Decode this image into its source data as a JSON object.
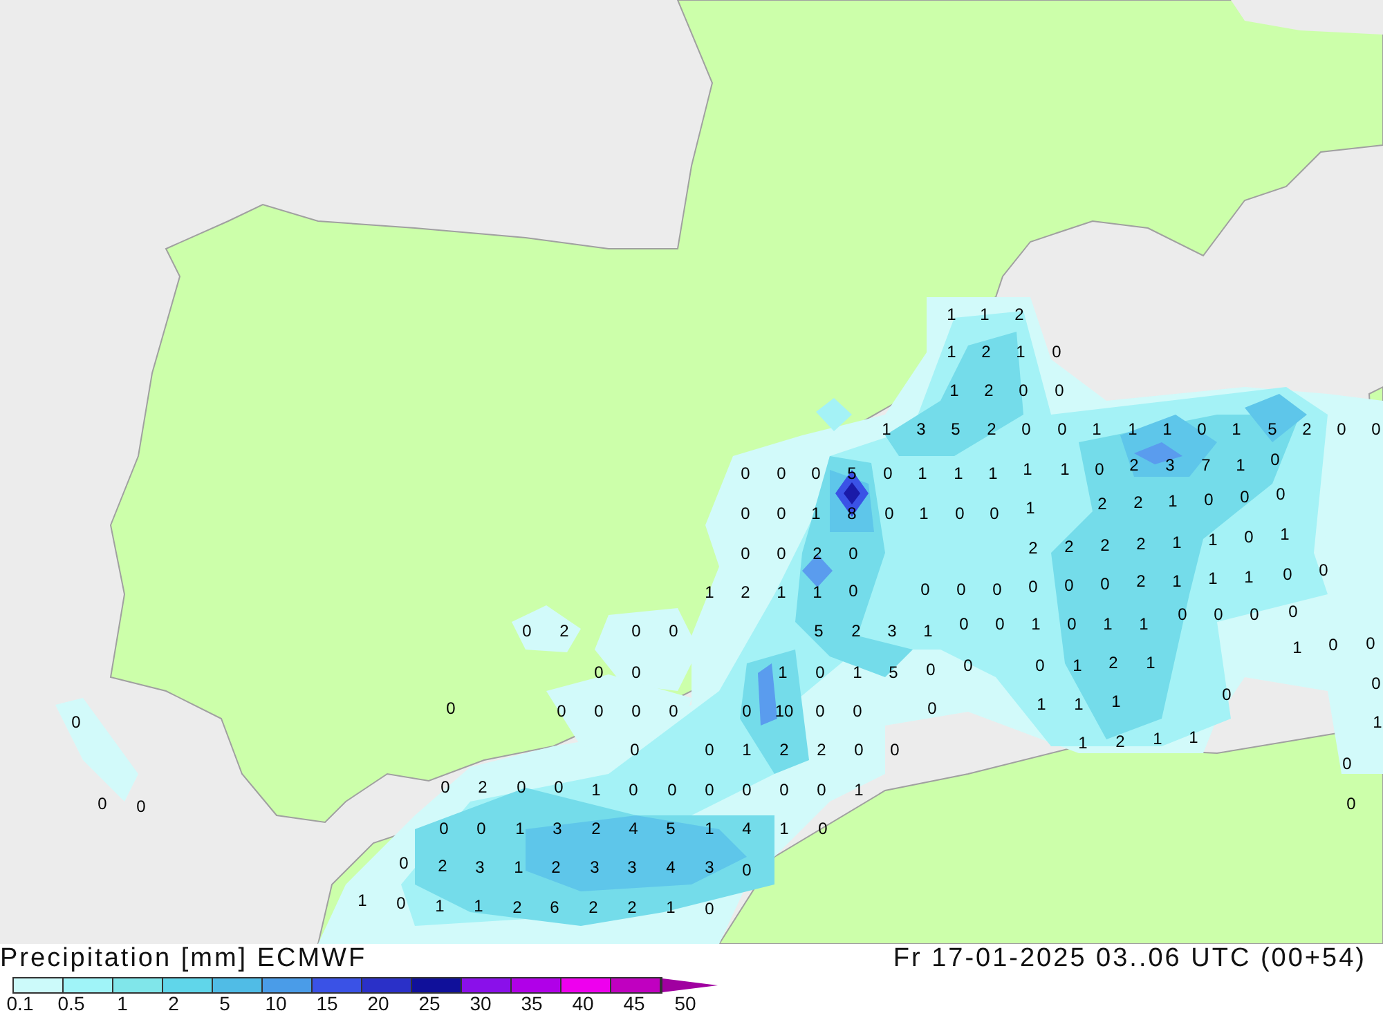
{
  "map": {
    "values": [
      "1",
      "1",
      "2",
      "1",
      "2",
      "1",
      "0",
      "1",
      "2",
      "0",
      "0",
      "1",
      "3",
      "5",
      "2",
      "0",
      "0",
      "1",
      "1",
      "1",
      "0",
      "1",
      "5",
      "2",
      "0",
      "0",
      "0",
      "0",
      "0",
      "5",
      "0",
      "1",
      "1",
      "1",
      "1",
      "1",
      "0",
      "2",
      "3",
      "7",
      "1",
      "0",
      "0",
      "0",
      "1",
      "8",
      "0",
      "1",
      "0",
      "0",
      "1",
      "2",
      "2",
      "1",
      "0",
      "0",
      "0",
      "0",
      "0",
      "2",
      "0",
      "2",
      "2",
      "2",
      "2",
      "1",
      "1",
      "0",
      "1",
      "1",
      "2",
      "1",
      "1",
      "0",
      "0",
      "0",
      "0",
      "0",
      "0",
      "0",
      "2",
      "1",
      "1",
      "1",
      "0",
      "0",
      "5",
      "2",
      "3",
      "1",
      "0",
      "0",
      "1",
      "0",
      "1",
      "1",
      "0",
      "0",
      "0",
      "0",
      "0",
      "2",
      "0",
      "0",
      "1",
      "0",
      "0",
      "0",
      "0",
      "1",
      "0",
      "1",
      "5",
      "0",
      "0",
      "0",
      "1",
      "2",
      "1",
      "0",
      "0",
      "0",
      "0",
      "0",
      "0",
      "0",
      "0",
      "10",
      "0",
      "0",
      "0",
      "1",
      "1",
      "1",
      "0",
      "1",
      "0",
      "0",
      "1",
      "2",
      "2",
      "0",
      "0",
      "1",
      "2",
      "1",
      "1",
      "0",
      "0",
      "2",
      "0",
      "0",
      "1",
      "0",
      "0",
      "0",
      "0",
      "0",
      "0",
      "1",
      "0",
      "0",
      "0",
      "0",
      "0",
      "1",
      "3",
      "2",
      "4",
      "5",
      "1",
      "4",
      "1",
      "0",
      "0",
      "2",
      "3",
      "1",
      "2",
      "3",
      "3",
      "4",
      "3",
      "0",
      "1",
      "0",
      "1",
      "1",
      "2",
      "6",
      "2",
      "2",
      "1",
      "0"
    ]
  },
  "legend": {
    "title": "Precipitation [mm] ECMWF",
    "valid_time": "Fr 17-01-2025 03..06 UTC (00+54)",
    "bins": [
      {
        "color": "#ccfafa"
      },
      {
        "color": "#a0f4f8"
      },
      {
        "color": "#80e6ea"
      },
      {
        "color": "#60d6ea"
      },
      {
        "color": "#50bce6"
      },
      {
        "color": "#4a9ce8"
      },
      {
        "color": "#3a52e6"
      },
      {
        "color": "#2a30c8"
      },
      {
        "color": "#10109a"
      },
      {
        "color": "#8a10ea"
      },
      {
        "color": "#b000e8"
      },
      {
        "color": "#ee00ee"
      },
      {
        "color": "#c000c0"
      }
    ],
    "ticks": [
      "0.1",
      "0.5",
      "1",
      "2",
      "5",
      "10",
      "15",
      "20",
      "25",
      "30",
      "35",
      "40",
      "45",
      "50"
    ]
  }
}
